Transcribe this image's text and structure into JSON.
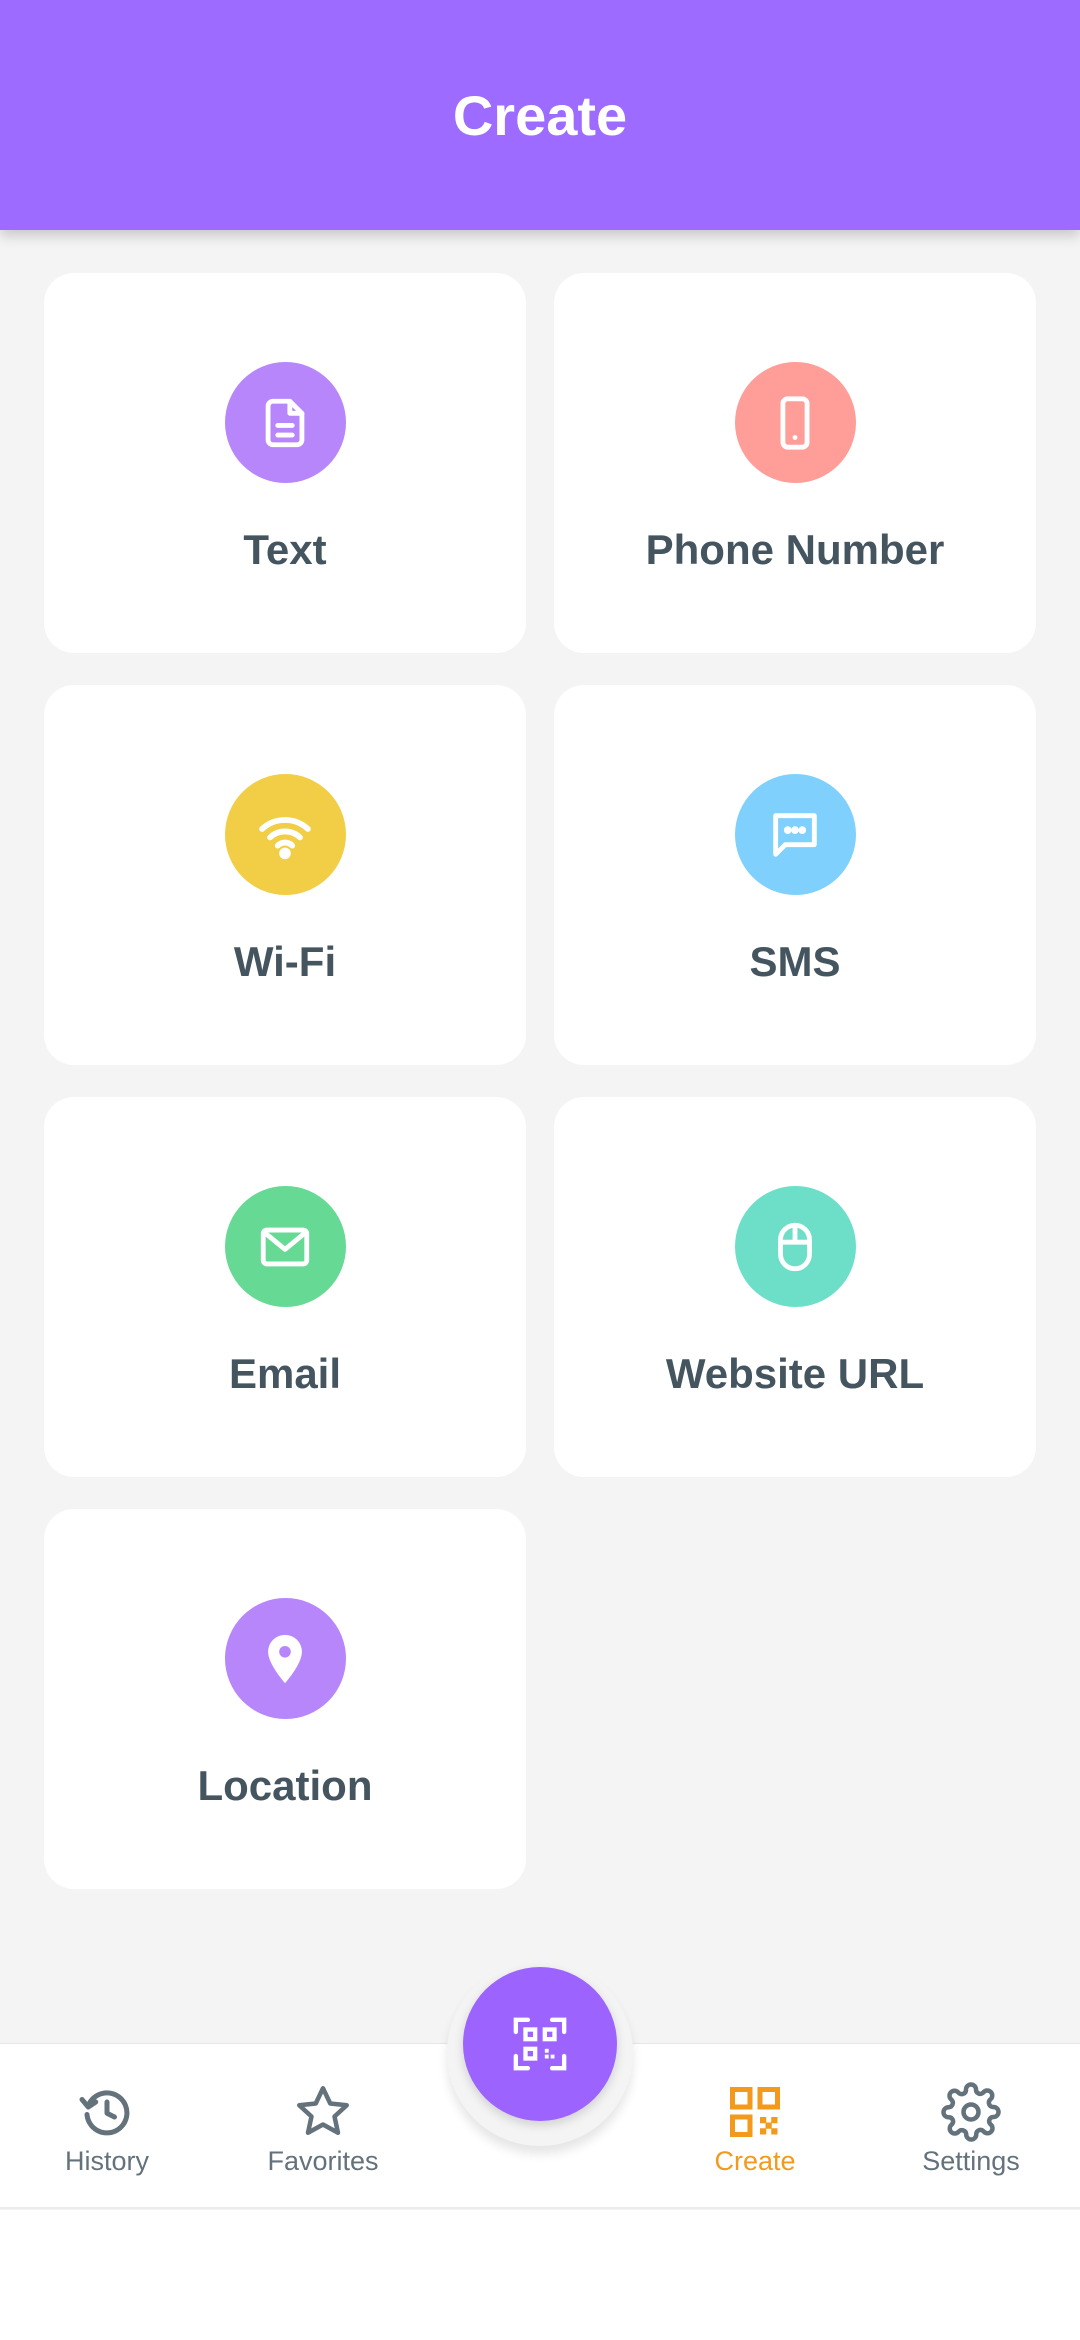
{
  "header": {
    "title": "Create"
  },
  "cards": [
    {
      "label": "Text",
      "icon": "document-icon",
      "color": "#b886fb"
    },
    {
      "label": "Phone Number",
      "icon": "phone-icon",
      "color": "#ff9d99"
    },
    {
      "label": "Wi-Fi",
      "icon": "wifi-icon",
      "color": "#f2cd46"
    },
    {
      "label": "SMS",
      "icon": "message-icon",
      "color": "#7fd0fd"
    },
    {
      "label": "Email",
      "icon": "mail-icon",
      "color": "#66d994"
    },
    {
      "label": "Website URL",
      "icon": "mouse-icon",
      "color": "#6ddfc9"
    },
    {
      "label": "Location",
      "icon": "location-pin-icon",
      "color": "#b886fb"
    }
  ],
  "bottom_nav": {
    "history": "History",
    "favorites": "Favorites",
    "create": "Create",
    "settings": "Settings",
    "active": "create",
    "fab_icon": "qr-scan-icon"
  },
  "colors": {
    "primary": "#9d6bff",
    "active": "#f39a1c",
    "label": "#455560"
  }
}
